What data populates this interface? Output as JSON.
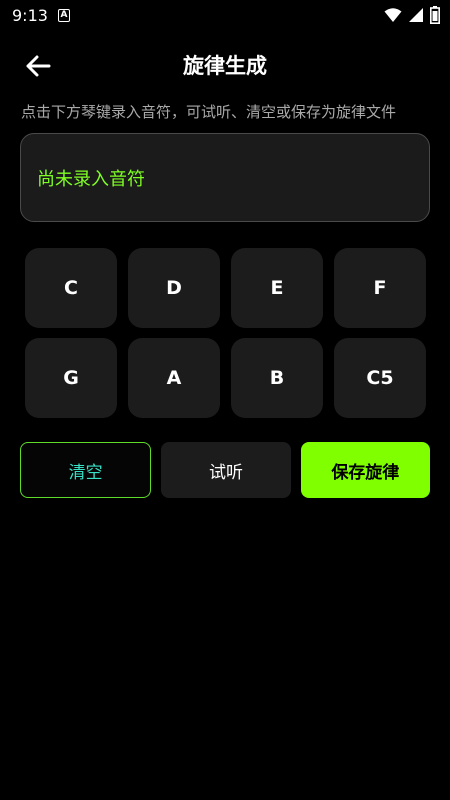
{
  "status_bar": {
    "time": "9:13",
    "notification_badge": "A",
    "icons": [
      "wifi-icon",
      "signal-icon",
      "battery-icon"
    ]
  },
  "header": {
    "back_icon": "arrow-left-icon",
    "title": "旋律生成"
  },
  "instruction": "点击下方琴键录入音符，可试听、清空或保存为旋律文件",
  "notes_display": {
    "text": "尚未录入音符"
  },
  "keys": [
    "C",
    "D",
    "E",
    "F",
    "G",
    "A",
    "B",
    "C5"
  ],
  "actions": {
    "clear_label": "清空",
    "listen_label": "试听",
    "save_label": "保存旋律"
  },
  "colors": {
    "background": "#000000",
    "accent_green": "#7fff00",
    "notes_text": "#7fff24",
    "clear_text": "#38e0c5",
    "key_bg": "#1c1c1c"
  }
}
